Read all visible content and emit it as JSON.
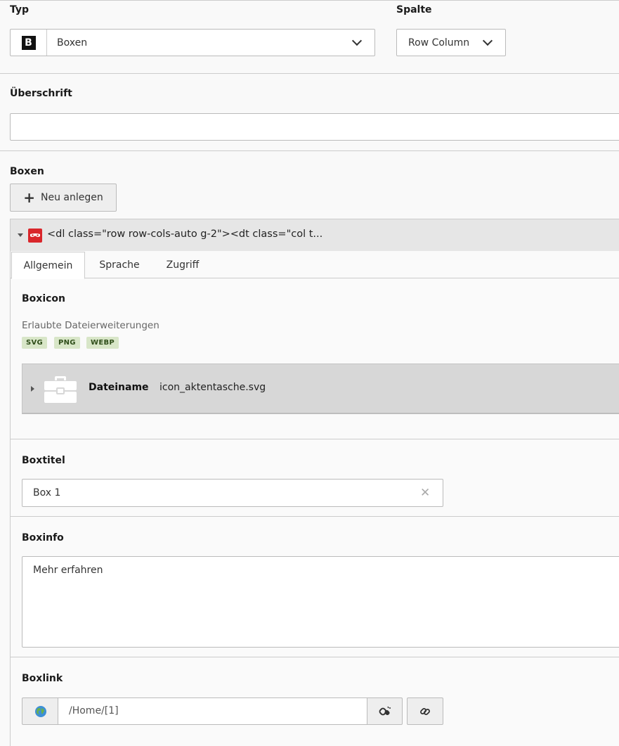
{
  "typ": {
    "label": "Typ",
    "icon": "b-icon",
    "icon_text": "B",
    "value": "Boxen"
  },
  "spalte": {
    "label": "Spalte",
    "value": "Row Column"
  },
  "ueberschrift": {
    "label": "Überschrift",
    "value": ""
  },
  "boxen": {
    "label": "Boxen",
    "new_button": "Neu anlegen",
    "record_title": "<dl class=\"row row-cols-auto g-2\"><dt class=\"col t...",
    "tabs": [
      {
        "label": "Allgemein",
        "active": true
      },
      {
        "label": "Sprache",
        "active": false
      },
      {
        "label": "Zugriff",
        "active": false
      }
    ],
    "boxicon": {
      "label": "Boxicon",
      "allowed_label": "Erlaubte Dateierweiterungen",
      "extensions": [
        "SVG",
        "PNG",
        "WEBP"
      ],
      "file_label": "Dateiname",
      "file_name": "icon_aktentasche.svg"
    },
    "boxtitel": {
      "label": "Boxtitel",
      "value": "Box 1"
    },
    "boxinfo": {
      "label": "Boxinfo",
      "value": "Mehr erfahren"
    },
    "boxlink": {
      "label": "Boxlink",
      "value": "/Home/[1]"
    }
  },
  "colors": {
    "accent_red": "#d9262b",
    "tag_bg": "#d8e6c8",
    "file_bar": "#d7d7d7"
  }
}
